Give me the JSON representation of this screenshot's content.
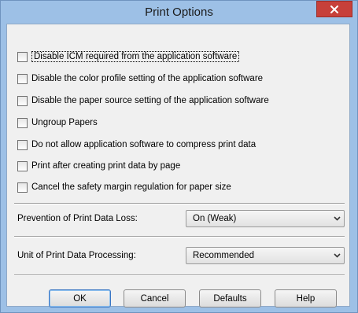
{
  "window": {
    "title": "Print Options"
  },
  "options": [
    {
      "label": "Disable ICM required from the application software",
      "checked": false,
      "focused": true
    },
    {
      "label": "Disable the color profile setting of the application software",
      "checked": false
    },
    {
      "label": "Disable the paper source setting of the application software",
      "checked": false
    },
    {
      "label": "Ungroup Papers",
      "checked": false
    },
    {
      "label": "Do not allow application software to compress print data",
      "checked": false
    },
    {
      "label": "Print after creating print data by page",
      "checked": false
    },
    {
      "label": "Cancel the safety margin regulation for paper size",
      "checked": false
    }
  ],
  "prevention": {
    "label": "Prevention of Print Data Loss:",
    "value": "On (Weak)"
  },
  "unit": {
    "label": "Unit of Print Data Processing:",
    "value": "Recommended"
  },
  "buttons": {
    "ok": "OK",
    "cancel": "Cancel",
    "defaults": "Defaults",
    "help": "Help"
  },
  "colors": {
    "frame": "#9dc0e6",
    "close": "#c7403a",
    "client": "#f0f0f0"
  },
  "icons": {
    "close": "close-icon",
    "dropdown": "chevron-down-icon"
  }
}
